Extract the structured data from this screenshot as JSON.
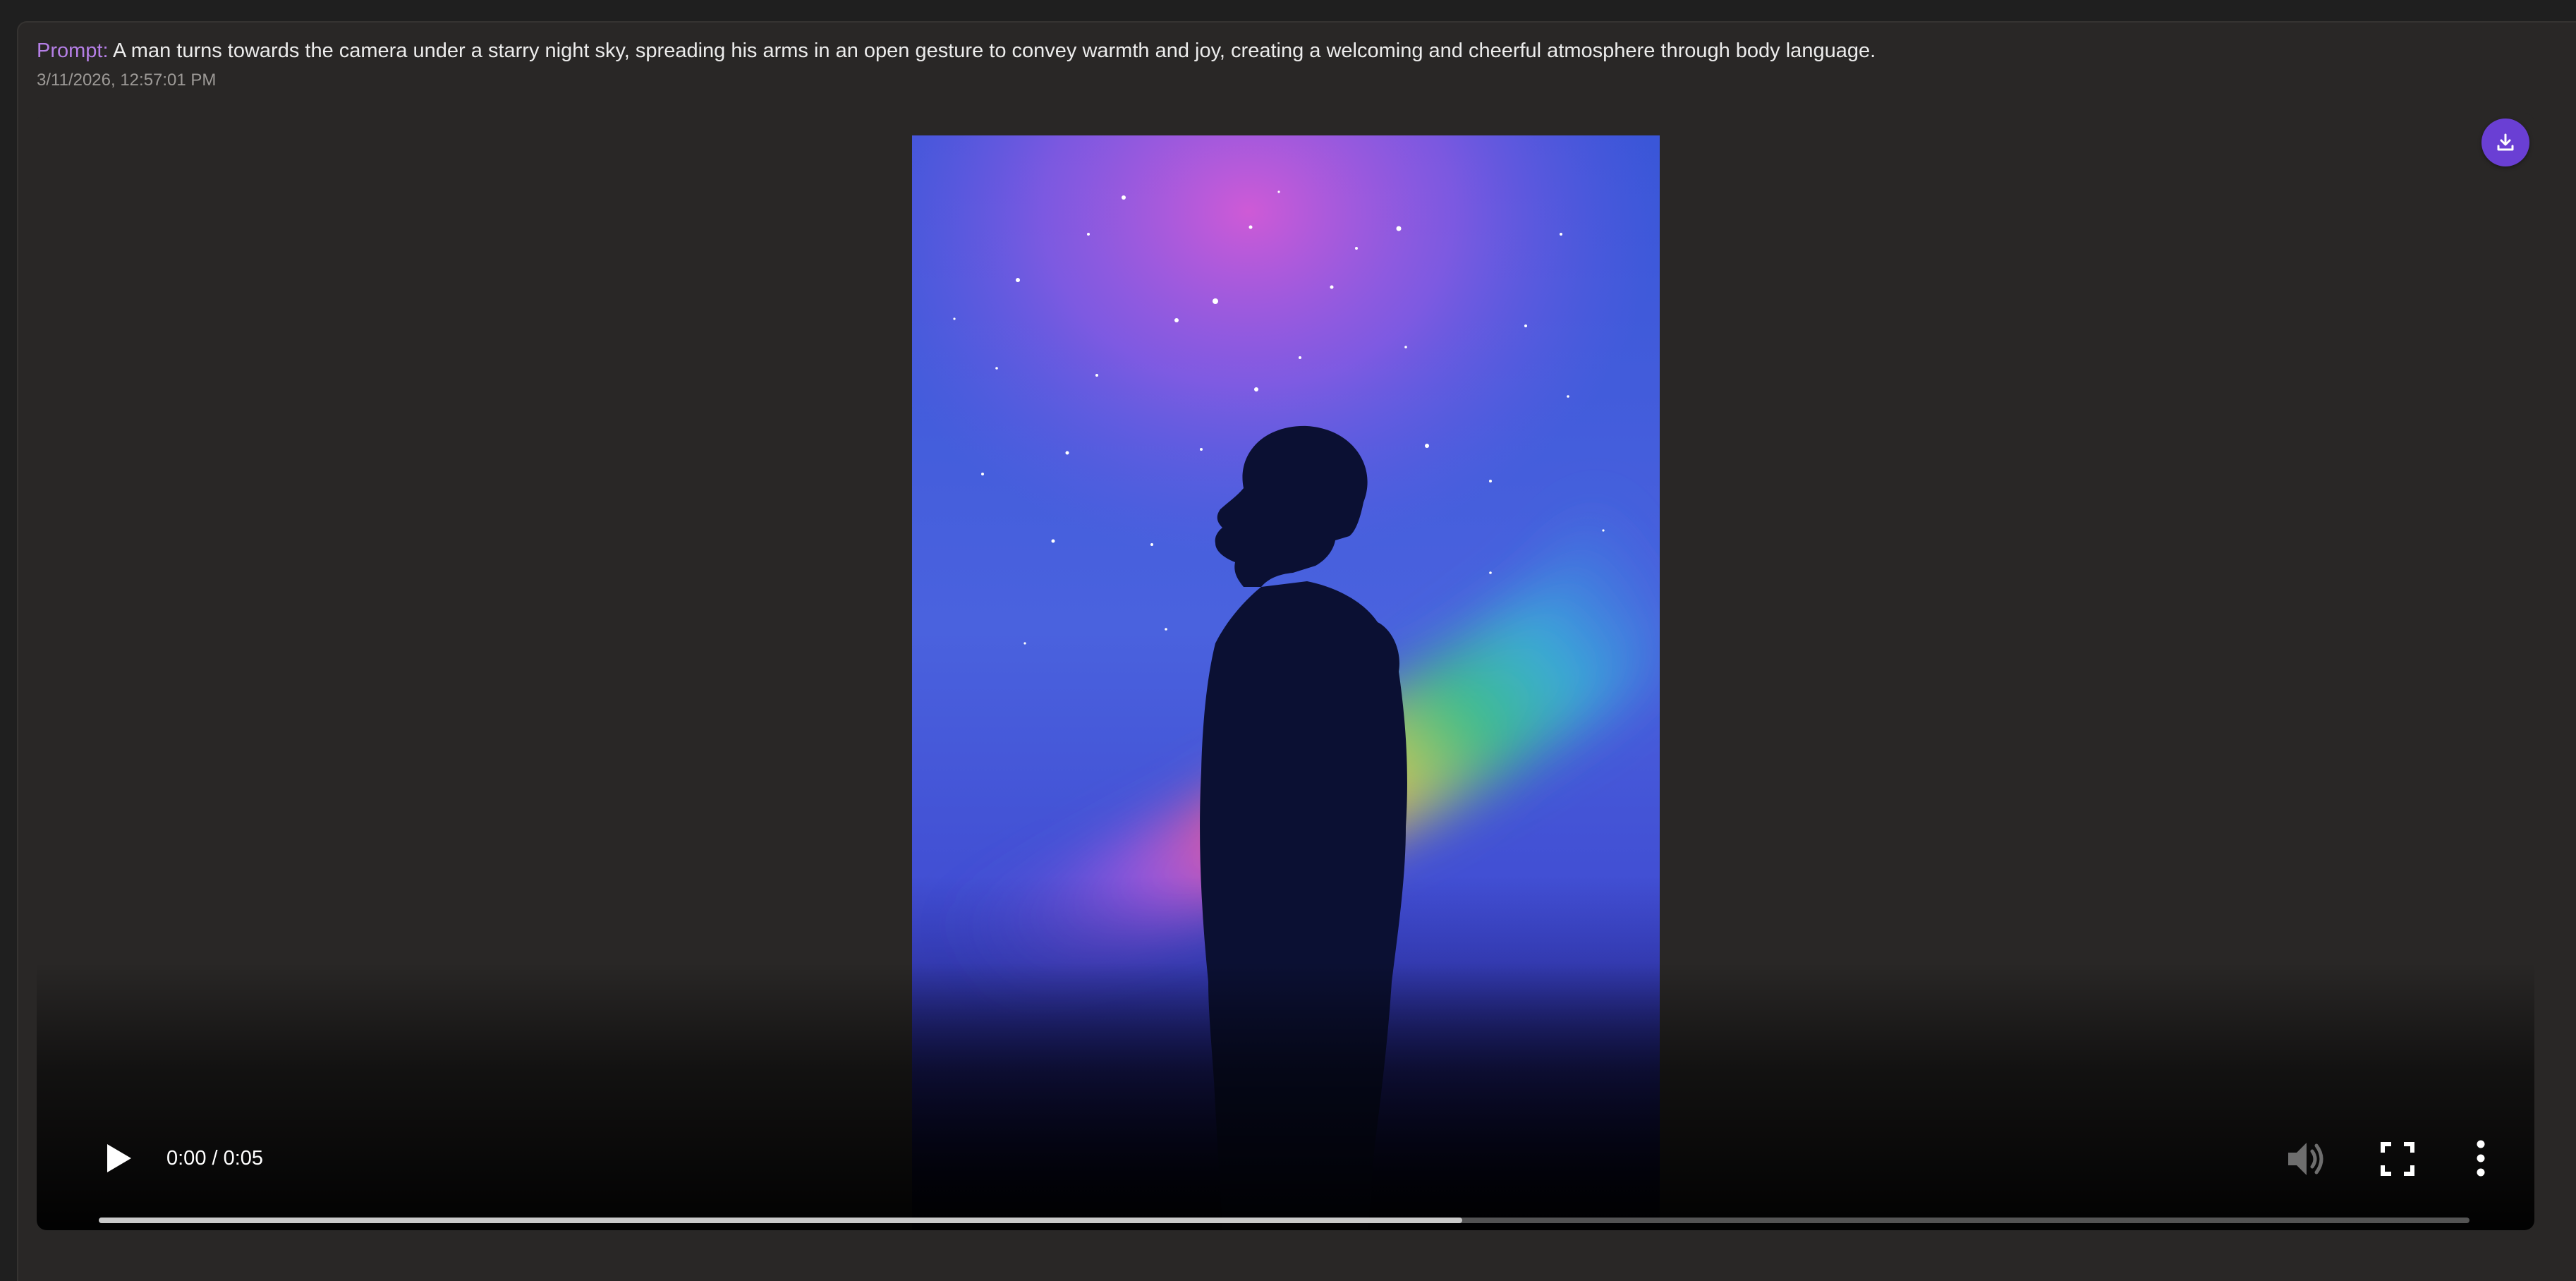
{
  "prompt": {
    "label": "Prompt:",
    "text": "A man turns towards the camera under a starry night sky, spreading his arms in an open gesture to convey warmth and joy, creating a welcoming and cheerful atmosphere through body language."
  },
  "timestamp": "3/11/2026, 12:57:01 PM",
  "download": {
    "icon": "download-icon",
    "color": "#6a3fd4"
  },
  "player": {
    "current_time": "0:00",
    "duration": "0:05",
    "time_text": "0:00 / 0:05",
    "progress_buffered_fraction": 0.575,
    "icons": {
      "play": "play-icon",
      "volume": "volume-icon",
      "fullscreen": "fullscreen-icon",
      "more": "more-vertical-icon"
    }
  },
  "colors": {
    "prompt_label": "#b57fe6",
    "card_background": "#292726",
    "page_background": "#1f1f1f"
  }
}
